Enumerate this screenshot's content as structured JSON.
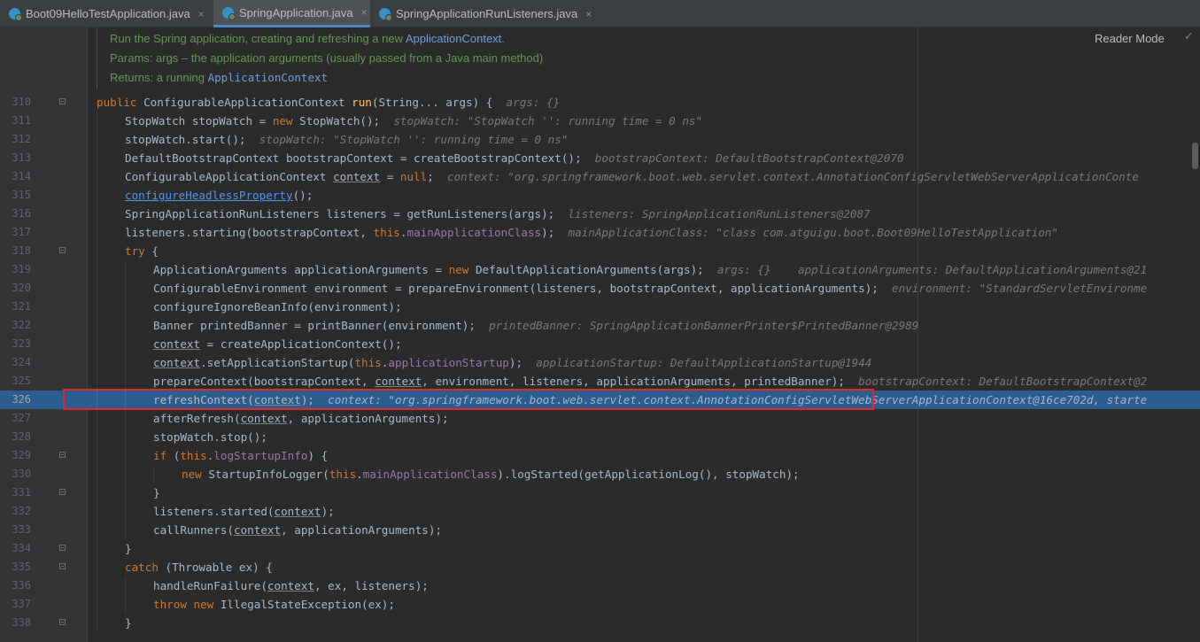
{
  "tabs": [
    {
      "label": "Boot09HelloTestApplication.java",
      "close": "×",
      "active": false
    },
    {
      "label": "SpringApplication.java",
      "close": "×",
      "active": true
    },
    {
      "label": "SpringApplicationRunListeners.java",
      "close": "×",
      "active": false
    }
  ],
  "doc": {
    "line1_prefix": "Run the Spring application, creating and refreshing a new ",
    "line1_link": "ApplicationContext",
    "line1_suffix": ".",
    "line2": "Params:  args – the application arguments (usually passed from a Java main method)",
    "line3_prefix": "Returns: a running ",
    "line3_link": "ApplicationContext"
  },
  "reader_mode": "Reader Mode",
  "check_icon": "✓",
  "line_numbers": [
    "310",
    "311",
    "312",
    "313",
    "314",
    "315",
    "316",
    "317",
    "318",
    "319",
    "320",
    "321",
    "322",
    "323",
    "324",
    "325",
    "326",
    "327",
    "328",
    "329",
    "330",
    "331",
    "332",
    "333",
    "334",
    "335",
    "336",
    "337",
    "338"
  ],
  "hints": {
    "h310": "args: {}",
    "h311": "stopWatch: \"StopWatch '': running time = 0 ns\"",
    "h312": "stopWatch: \"StopWatch '': running time = 0 ns\"",
    "h313": "bootstrapContext: DefaultBootstrapContext@2070",
    "h314": "context: \"org.springframework.boot.web.servlet.context.AnnotationConfigServletWebServerApplicationConte",
    "h316": "listeners: SpringApplicationRunListeners@2087",
    "h317": "mainApplicationClass: \"class com.atguigu.boot.Boot09HelloTestApplication\"",
    "h319a": "args: {}",
    "h319b": "applicationArguments: DefaultApplicationArguments@21",
    "h320": "environment: \"StandardServletEnvironme",
    "h322": "printedBanner: SpringApplicationBannerPrinter$PrintedBanner@2989",
    "h324": "applicationStartup: DefaultApplicationStartup@1944",
    "h325": "bootstrapContext: DefaultBootstrapContext@2",
    "h326": "context: \"org.springframework.boot.web.servlet.context.AnnotationConfigServletWebServerApplicationContext@16ce702d, starte"
  },
  "colors": {
    "background": "#2b2b2b",
    "selection": "#2d5d8f",
    "keyword": "#cc7832",
    "method": "#ffc66d",
    "field": "#9876aa",
    "doc": "#629755",
    "highlight_box": "#e3262a"
  }
}
